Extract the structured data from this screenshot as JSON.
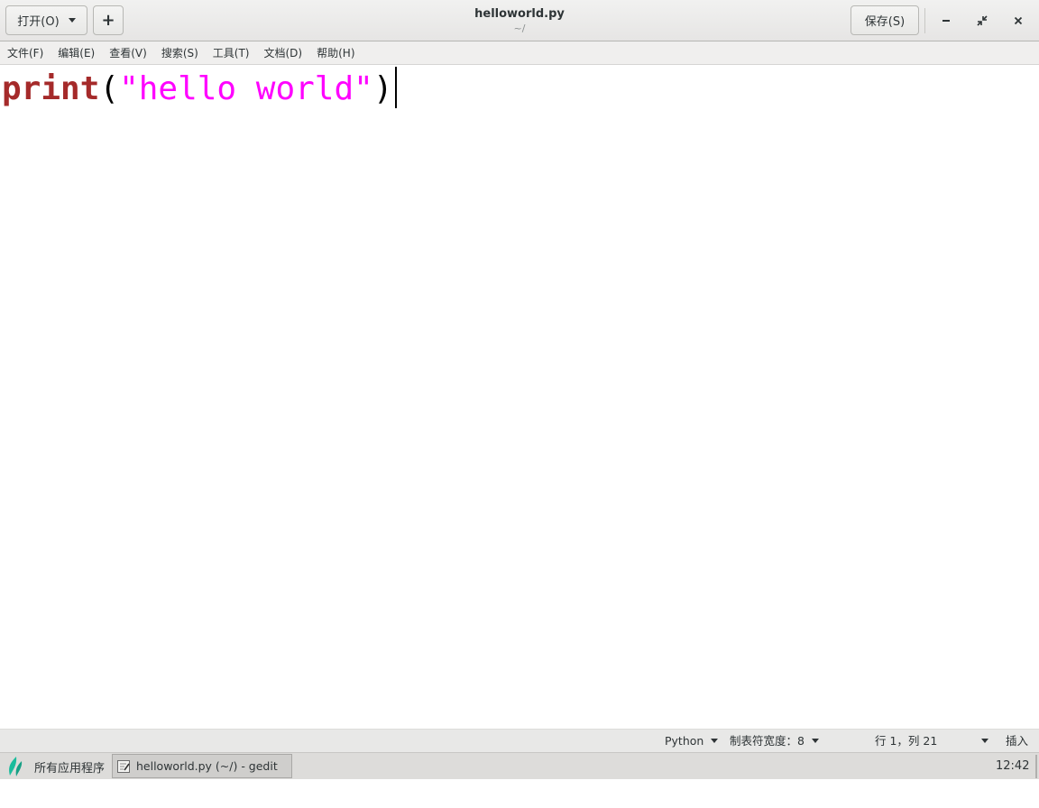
{
  "header": {
    "open_label": "打开(O)",
    "new_tab_label": "+",
    "title": "helloworld.py",
    "subtitle": "~/",
    "save_label": "保存(S)",
    "icons": {
      "open_dropdown": "chevron-down-icon",
      "minimize": "minimize-icon",
      "restore": "restore-icon",
      "close": "close-icon"
    }
  },
  "menubar": {
    "items": [
      {
        "label": "文件(F)"
      },
      {
        "label": "编辑(E)"
      },
      {
        "label": "查看(V)"
      },
      {
        "label": "搜索(S)"
      },
      {
        "label": "工具(T)"
      },
      {
        "label": "文档(D)"
      },
      {
        "label": "帮助(H)"
      }
    ]
  },
  "editor": {
    "tokens": {
      "keyword": "print",
      "open_paren": "(",
      "string": "\"hello world\"",
      "close_paren": ")"
    },
    "colors": {
      "keyword": "#a52a2a",
      "string": "#ff00ff"
    }
  },
  "statusbar": {
    "language": "Python",
    "tab_width": "制表符宽度：8",
    "position": "行 1，列 21",
    "mode": "插入"
  },
  "taskbar": {
    "apps_label": "所有应用程序",
    "task_label": "helloworld.py (~/) - gedit",
    "clock": "12:42"
  }
}
